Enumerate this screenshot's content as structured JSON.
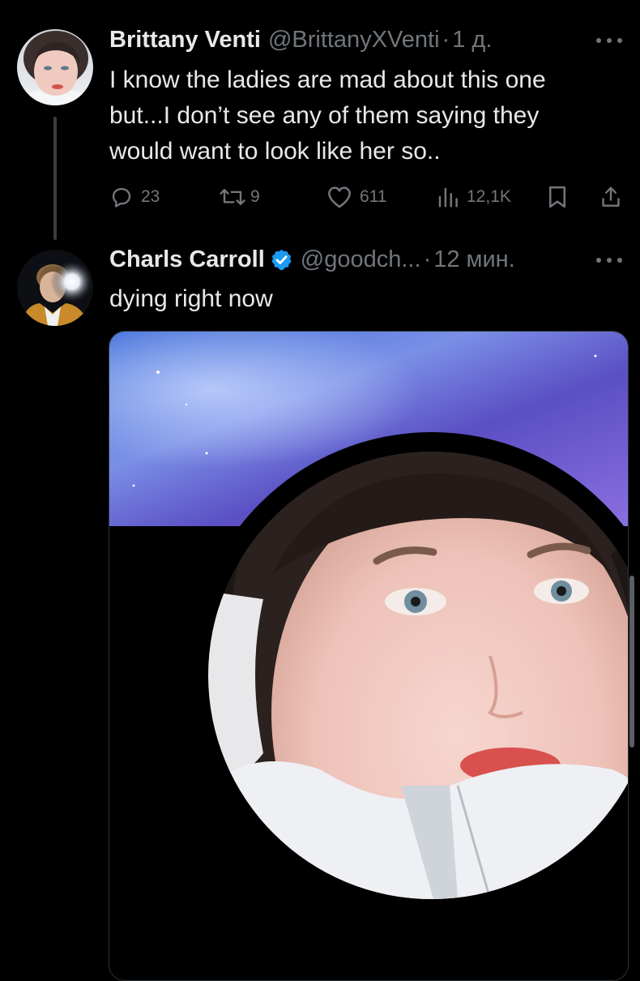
{
  "colors": {
    "background": "#000000",
    "text_primary": "#e7e9ea",
    "text_secondary": "#71767b",
    "verified_badge": "#1d9bf0",
    "thread_line": "#3a3d41"
  },
  "tweets": [
    {
      "author_name": "Brittany Venti",
      "handle": "@BrittanyXVenti",
      "separator": "·",
      "timestamp": "1 д.",
      "verified": false,
      "text_lines": [
        "I know the ladies are mad about this one",
        "but...I don’t see any of them saying they",
        "would want to look like her so.."
      ],
      "actions": {
        "reply": {
          "icon": "reply-icon",
          "count": "23"
        },
        "retweet": {
          "icon": "retweet-icon",
          "count": "9"
        },
        "like": {
          "icon": "heart-icon",
          "count": "611"
        },
        "views": {
          "icon": "views-icon",
          "count": "12,1K"
        },
        "bookmark": {
          "icon": "bookmark-icon"
        },
        "share": {
          "icon": "share-icon"
        }
      }
    },
    {
      "author_name": "Charls Carroll",
      "handle": "@goodch...",
      "separator": "·",
      "timestamp": "12 мин.",
      "verified": true,
      "text_lines": [
        "dying right now"
      ],
      "media": {
        "type": "photo",
        "icon": "attached-photo"
      }
    }
  ]
}
